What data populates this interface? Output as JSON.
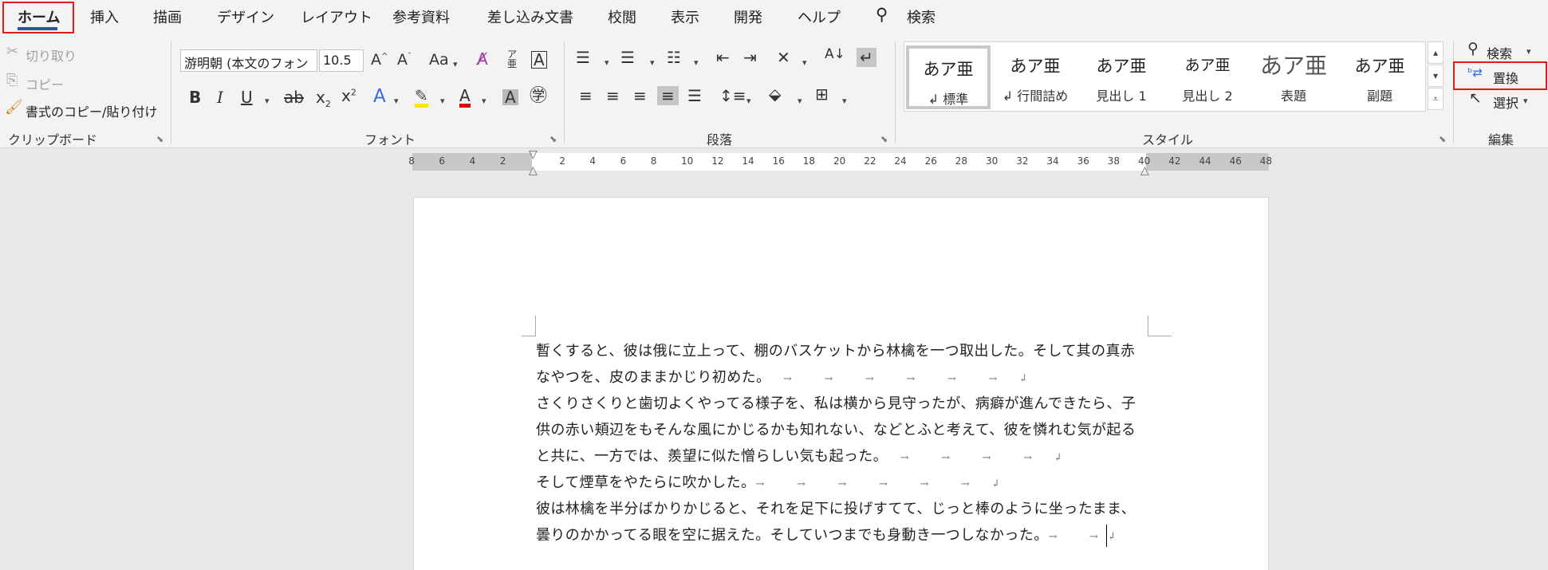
{
  "tabs": [
    "ホーム",
    "挿入",
    "描画",
    "デザイン",
    "レイアウト",
    "参考資料",
    "差し込み文書",
    "校閲",
    "表示",
    "開発",
    "ヘルプ"
  ],
  "search": {
    "label": "検索"
  },
  "clipboard": {
    "cut": "切り取り",
    "copy": "コピー",
    "format_painter": "書式のコピー/貼り付け",
    "group_label": "クリップボード"
  },
  "font": {
    "name": "游明朝 (本文のフォン",
    "size": "10.5",
    "group_label": "フォント"
  },
  "paragraph": {
    "group_label": "段落"
  },
  "styles": {
    "items": [
      {
        "sample": "あア亜",
        "name": "↲ 標準"
      },
      {
        "sample": "あア亜",
        "name": "↲ 行間詰め"
      },
      {
        "sample": "あア亜",
        "name": "見出し 1"
      },
      {
        "sample": "あア亜",
        "name": "見出し 2"
      },
      {
        "sample": "あア亜",
        "name": "表題"
      },
      {
        "sample": "あア亜",
        "name": "副題"
      }
    ],
    "group_label": "スタイル"
  },
  "editing": {
    "find": "検索",
    "replace": "置換",
    "select": "選択",
    "group_label": "編集"
  },
  "ruler": {
    "left_numbers": [
      "8",
      "6",
      "4",
      "2"
    ],
    "right_numbers": [
      "2",
      "4",
      "6",
      "8",
      "10",
      "12",
      "14",
      "16",
      "18",
      "20",
      "22",
      "24",
      "26",
      "28",
      "30",
      "32",
      "34",
      "36",
      "38",
      "40",
      "42",
      "44",
      "46",
      "48"
    ]
  },
  "document": {
    "lines": [
      "暫くすると、彼は俄に立上って、棚のバスケットから林檎を一つ取出した。そして其の真赤",
      "なやつを、皮のままかじり初めた。",
      "さくりさくりと歯切よくやってる様子を、私は横から見守ったが、病癖が進んできたら、子",
      "供の赤い頬辺をもそんな風にかじるかも知れない、などとふと考えて、彼を憐れむ気が起る",
      "と共に、一方では、羨望に似た憎らしい気も起った。",
      "そして煙草をやたらに吹かした。",
      "彼は林檎を半分ばかりかじると、それを足下に投げすてて、じっと棒のように坐ったまま、",
      "曇りのかかってる眼を空に据えた。そしていつまでも身動き一つしなかった。"
    ],
    "line_marks": [
      "",
      "→　　　→　　　→　　　→　　　→　　　→　　↲",
      "",
      "",
      "→　　　→　　　→　　　→　　↲",
      "→　　　→　　　→　　　→　　　→　　　→　　↲",
      "",
      "→　　　→"
    ],
    "end_mark": "↲"
  }
}
